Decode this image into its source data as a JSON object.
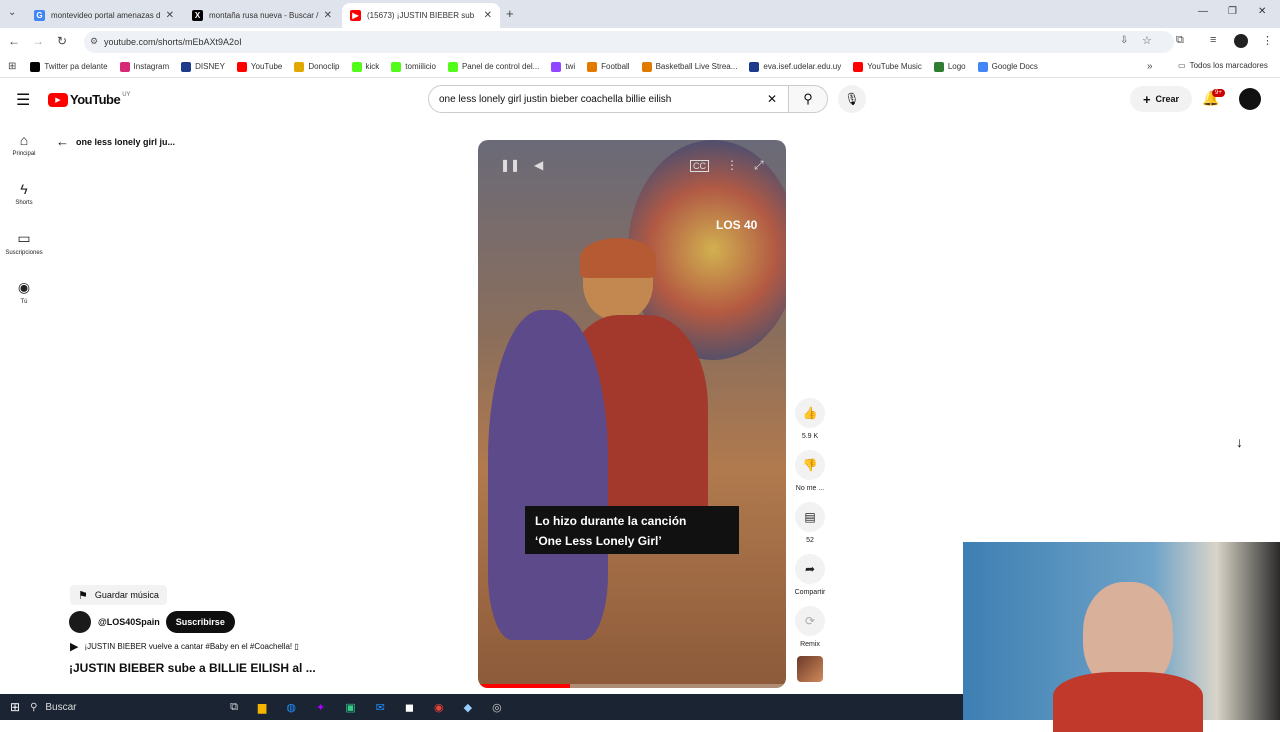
{
  "browser": {
    "tabs": [
      {
        "title": "montevideo portal amenazas d",
        "color": "#4285f4",
        "active": false
      },
      {
        "title": "montaña rusa nueva - Buscar /",
        "color": "#000000",
        "active": false
      },
      {
        "title": "(15673) ¡JUSTIN BIEBER sub",
        "color": "#ff0000",
        "active": true
      }
    ],
    "url": "youtube.com/shorts/mEbAXt9A2oI",
    "bookmarks": [
      {
        "label": "Twitter pa delante",
        "color": "#000000"
      },
      {
        "label": "Instagram",
        "color": "#d62976"
      },
      {
        "label": "DISNEY",
        "color": "#1e3a8a"
      },
      {
        "label": "YouTube",
        "color": "#ff0000"
      },
      {
        "label": "Donoclip",
        "color": "#e0a800"
      },
      {
        "label": "kick",
        "color": "#53fc18"
      },
      {
        "label": "tomiilicio",
        "color": "#53fc18"
      },
      {
        "label": "Panel de control del...",
        "color": "#53fc18"
      },
      {
        "label": "twi",
        "color": "#9146ff"
      },
      {
        "label": "Football",
        "color": "#e07b00"
      },
      {
        "label": "Basketball Live Strea...",
        "color": "#e07b00"
      },
      {
        "label": "eva.isef.udelar.edu.uy",
        "color": "#1e3a8a"
      },
      {
        "label": "YouTube Music",
        "color": "#ff0000"
      },
      {
        "label": "Logo",
        "color": "#2e7d32"
      },
      {
        "label": "Google Docs",
        "color": "#4285f4"
      }
    ],
    "all_bookmarks": "Todos los marcadores"
  },
  "youtube": {
    "logo": "YouTube",
    "region": "UY",
    "search_value": "one less lonely girl justin bieber coachella billie eilish",
    "create_label": "Crear",
    "notif_count": "9+",
    "sidebar": [
      {
        "label": "Principal",
        "icon": "home-icon"
      },
      {
        "label": "Shorts",
        "icon": "shorts-icon"
      },
      {
        "label": "Suscripciones",
        "icon": "subscriptions-icon"
      },
      {
        "label": "Tú",
        "icon": "you-icon"
      }
    ],
    "back_title": "one less lonely girl ju...",
    "caption_line1": "Lo hizo durante la canción",
    "caption_line2": "‘One Less Lonely Girl’",
    "watermark": "LOS 40",
    "actions": [
      {
        "label": "5.9 K",
        "icon": "thumbs-up-icon"
      },
      {
        "label": "No me ...",
        "icon": "thumbs-down-icon"
      },
      {
        "label": "52",
        "icon": "comment-icon"
      },
      {
        "label": "Compartir",
        "icon": "share-icon"
      },
      {
        "label": "Remix",
        "icon": "remix-icon"
      }
    ],
    "save_music": "Guardar música",
    "channel": "@LOS40Spain",
    "subscribe": "Suscribirse",
    "track": "¡JUSTIN BIEBER vuelve a cantar #Baby en el #Coachella! ▯",
    "video_title": "¡JUSTIN BIEBER sube a BILLIE EILISH al ...",
    "progress": 0.3
  },
  "taskbar": {
    "search_placeholder": "Buscar"
  }
}
